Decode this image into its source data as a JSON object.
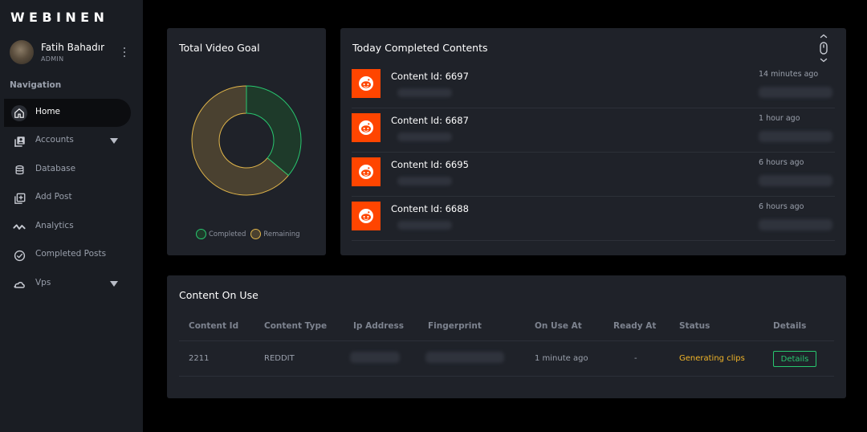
{
  "app": {
    "logo": "WEBINEN"
  },
  "user": {
    "name": "Fatih Bahadır",
    "role": "ADMIN"
  },
  "sidebar": {
    "heading": "Navigation",
    "items": [
      {
        "label": "Home",
        "icon": "home-icon",
        "active": true
      },
      {
        "label": "Accounts",
        "icon": "accounts-icon",
        "dropdown": true
      },
      {
        "label": "Database",
        "icon": "database-icon"
      },
      {
        "label": "Add Post",
        "icon": "add-post-icon"
      },
      {
        "label": "Analytics",
        "icon": "analytics-icon"
      },
      {
        "label": "Completed Posts",
        "icon": "check-circle-icon"
      },
      {
        "label": "Vps",
        "icon": "cloud-icon",
        "dropdown": true
      }
    ]
  },
  "video_goal": {
    "title": "Total Video Goal",
    "completed_fraction": 0.36,
    "legend": {
      "completed": "Completed",
      "remaining": "Remaining"
    },
    "colors": {
      "completed": "#28c76f",
      "remaining": "#e0b54a"
    }
  },
  "today": {
    "title": "Today Completed Contents",
    "items": [
      {
        "title": "Content Id: 6697",
        "time": "14 minutes ago"
      },
      {
        "title": "Content Id: 6687",
        "time": "1 hour ago"
      },
      {
        "title": "Content Id: 6695",
        "time": "6 hours ago"
      },
      {
        "title": "Content Id: 6688",
        "time": "6 hours ago"
      }
    ]
  },
  "content_on_use": {
    "title": "Content On Use",
    "columns": [
      "Content Id",
      "Content Type",
      "Ip Address",
      "Fingerprint",
      "On Use At",
      "Ready At",
      "Status",
      "Details"
    ],
    "rows": [
      {
        "id": "2211",
        "type": "REDDIT",
        "on_use_at": "1 minute ago",
        "ready_at": "-",
        "status": "Generating clips",
        "details_label": "Details"
      }
    ]
  },
  "colors": {
    "accent_green": "#28c76f",
    "status_yellow": "#f0b429",
    "reddit_orange": "#ff4500"
  }
}
